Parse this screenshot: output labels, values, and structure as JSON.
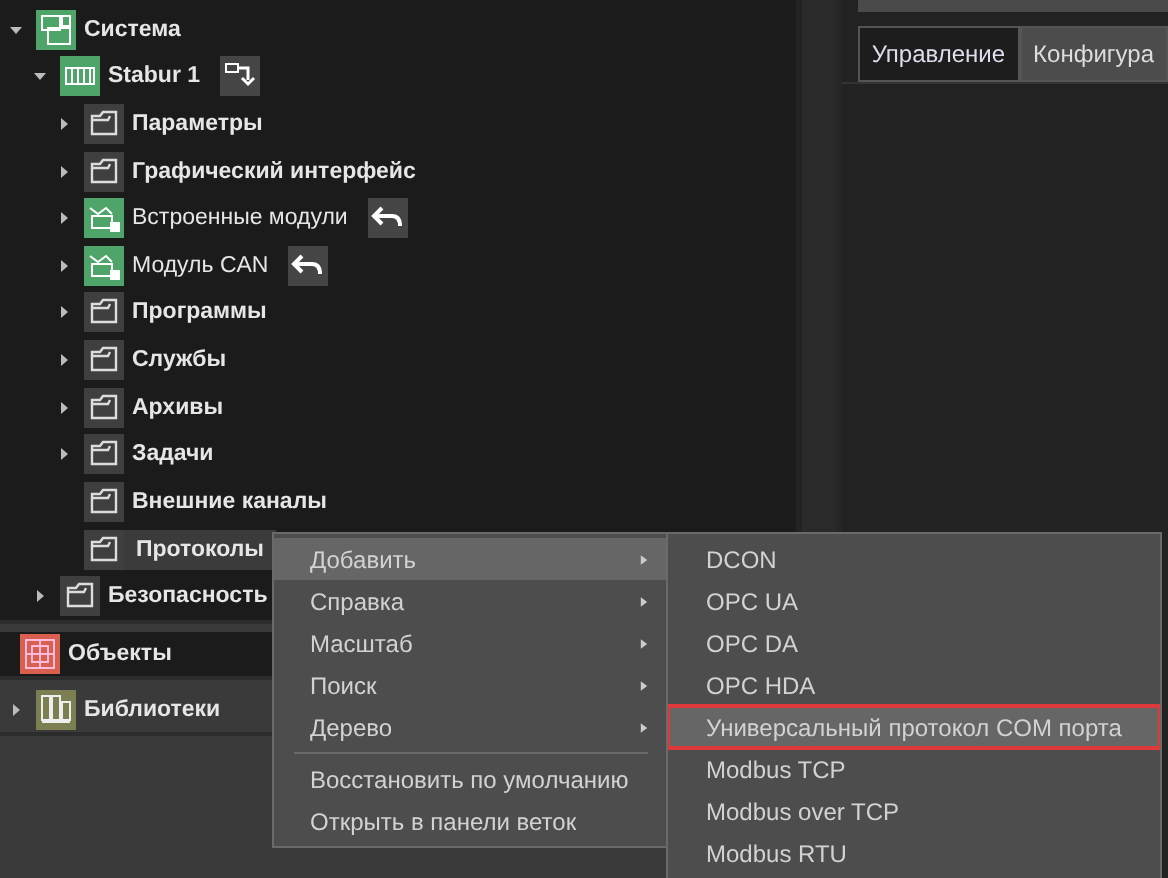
{
  "tree": [
    {
      "label": "Система",
      "kind": "system",
      "has_children": true,
      "expanded": true,
      "selected": false,
      "dropdown_button": false,
      "undo_button": false,
      "children": [
        {
          "label": "Stabur 1",
          "kind": "device",
          "has_children": true,
          "expanded": true,
          "selected": false,
          "dropdown_button": true,
          "undo_button": false,
          "children": [
            {
              "label": "Параметры",
              "kind": "folder",
              "has_children": true,
              "expanded": false,
              "selected": false,
              "dropdown_button": false,
              "undo_button": false
            },
            {
              "label": "Графический интерфейс",
              "kind": "folder",
              "has_children": true,
              "expanded": false,
              "selected": false,
              "dropdown_button": false,
              "undo_button": false
            },
            {
              "label": "Встроенные модули",
              "kind": "module",
              "has_children": true,
              "expanded": false,
              "selected": false,
              "dropdown_button": false,
              "undo_button": true
            },
            {
              "label": "Модуль CAN",
              "kind": "module",
              "has_children": true,
              "expanded": false,
              "selected": false,
              "dropdown_button": false,
              "undo_button": true
            },
            {
              "label": "Программы",
              "kind": "folder",
              "has_children": true,
              "expanded": false,
              "selected": false,
              "dropdown_button": false,
              "undo_button": false
            },
            {
              "label": "Службы",
              "kind": "folder",
              "has_children": true,
              "expanded": false,
              "selected": false,
              "dropdown_button": false,
              "undo_button": false
            },
            {
              "label": "Архивы",
              "kind": "folder",
              "has_children": true,
              "expanded": false,
              "selected": false,
              "dropdown_button": false,
              "undo_button": false
            },
            {
              "label": "Задачи",
              "kind": "folder",
              "has_children": true,
              "expanded": false,
              "selected": false,
              "dropdown_button": false,
              "undo_button": false
            },
            {
              "label": "Внешние каналы",
              "kind": "folder",
              "has_children": false,
              "selected": false,
              "dropdown_button": false,
              "undo_button": false
            },
            {
              "label": "Протоколы",
              "kind": "folder",
              "has_children": false,
              "selected": true,
              "dropdown_button": false,
              "undo_button": false
            }
          ]
        },
        {
          "label": "Безопасность",
          "kind": "folder",
          "has_children": true,
          "expanded": false,
          "selected": false,
          "dropdown_button": false,
          "undo_button": false
        }
      ]
    }
  ],
  "sections": [
    {
      "label": "Объекты",
      "kind": "objects",
      "has_children": false,
      "selected": true
    },
    {
      "label": "Библиотеки",
      "kind": "libraries",
      "has_children": true,
      "expanded": false,
      "selected": false
    }
  ],
  "tabs": [
    {
      "label": "Управление",
      "selected": true
    },
    {
      "label": "Конфигура",
      "selected": false
    }
  ],
  "context_menu": [
    {
      "label": "Добавить",
      "submenu": true,
      "selected": true,
      "separator_before": false
    },
    {
      "label": "Справка",
      "submenu": true,
      "selected": false,
      "separator_before": false
    },
    {
      "label": "Масштаб",
      "submenu": true,
      "selected": false,
      "separator_before": false
    },
    {
      "label": "Поиск",
      "submenu": true,
      "selected": false,
      "separator_before": false
    },
    {
      "label": "Дерево",
      "submenu": true,
      "selected": false,
      "separator_before": false
    },
    {
      "label": "Восстановить по умолчанию",
      "submenu": false,
      "selected": false,
      "separator_before": true
    },
    {
      "label": "Открыть в панели веток",
      "submenu": false,
      "selected": false,
      "separator_before": false
    }
  ],
  "submenu": [
    {
      "label": "DCON",
      "selected": false,
      "outlined": false
    },
    {
      "label": "OPC UA",
      "selected": false,
      "outlined": false
    },
    {
      "label": "OPC DA",
      "selected": false,
      "outlined": false
    },
    {
      "label": "OPC HDA",
      "selected": false,
      "outlined": false
    },
    {
      "label": "Универсальный протокол COM порта",
      "selected": true,
      "outlined": true
    },
    {
      "label": "Modbus TCP",
      "selected": false,
      "outlined": false
    },
    {
      "label": "Modbus over TCP",
      "selected": false,
      "outlined": false
    },
    {
      "label": "Modbus RTU",
      "selected": false,
      "outlined": false
    }
  ]
}
